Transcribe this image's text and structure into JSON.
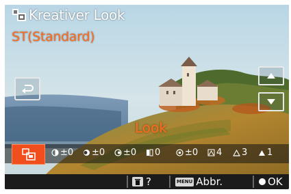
{
  "header": {
    "title": "Kreativer Look",
    "subtitle": "ST(Standard)"
  },
  "overlay": {
    "look_label": "Look"
  },
  "params": [
    {
      "name": "contrast",
      "icon": "contrast-icon",
      "value": "±0"
    },
    {
      "name": "highlights",
      "icon": "highlights-icon",
      "value": "±0"
    },
    {
      "name": "shadows",
      "icon": "shadows-icon",
      "value": "±0"
    },
    {
      "name": "fade",
      "icon": "fade-icon",
      "value": "0"
    },
    {
      "name": "saturation",
      "icon": "saturation-icon",
      "value": "±0"
    },
    {
      "name": "sharpness",
      "icon": "sharpness-icon",
      "value": "4"
    },
    {
      "name": "sharpness-range",
      "icon": "sharpness-range-icon",
      "value": "3"
    },
    {
      "name": "clarity",
      "icon": "clarity-icon",
      "value": "1"
    }
  ],
  "guide": {
    "delete_hint": "?",
    "menu_chip": "MENU",
    "menu_label": "Abbr.",
    "ok_label": "OK"
  },
  "colors": {
    "accent": "#ff6a1a",
    "selected_box": "#f04e1c"
  }
}
